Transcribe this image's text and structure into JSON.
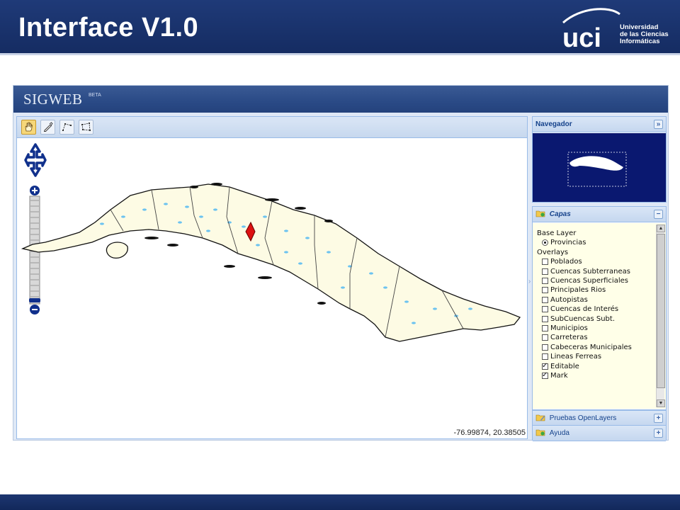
{
  "slide": {
    "title": "Interface V1.0",
    "logo": {
      "mark": "uci",
      "lines": [
        "Universidad",
        "de las Ciencias",
        "Informáticas"
      ]
    }
  },
  "app": {
    "brand": "SIGWEB",
    "brand_sup": "BETA"
  },
  "toolbar": {
    "tools": [
      {
        "name": "pan-hand-icon",
        "active": true
      },
      {
        "name": "draw-feature-icon",
        "active": false
      },
      {
        "name": "draw-line-icon",
        "active": false
      },
      {
        "name": "draw-polygon-icon",
        "active": false
      }
    ]
  },
  "map": {
    "coordinates": "-76.99874, 20.38505",
    "marker_color": "#dd1111",
    "land_color": "#fdfbe4",
    "water_color": "#6cc3f0"
  },
  "panels": {
    "navigator": {
      "title": "Navegador",
      "toggle": "»"
    },
    "layers": {
      "title": "Capas",
      "toggle": "−",
      "base_layer_label": "Base Layer",
      "base_layers": [
        {
          "label": "Provincias",
          "checked": true
        }
      ],
      "overlays_label": "Overlays",
      "overlays": [
        {
          "label": "Poblados",
          "checked": false
        },
        {
          "label": "Cuencas Subterraneas",
          "checked": false
        },
        {
          "label": "Cuencas Superficiales",
          "checked": false
        },
        {
          "label": "Principales Rios",
          "checked": false
        },
        {
          "label": "Autopistas",
          "checked": false
        },
        {
          "label": "Cuencas de Interés",
          "checked": false
        },
        {
          "label": "SubCuencas Subt.",
          "checked": false
        },
        {
          "label": "Municipios",
          "checked": false
        },
        {
          "label": "Carreteras",
          "checked": false
        },
        {
          "label": "Cabeceras Municipales",
          "checked": false
        },
        {
          "label": "Lineas Ferreas",
          "checked": false
        },
        {
          "label": "Editable",
          "checked": true
        },
        {
          "label": "Mark",
          "checked": true
        }
      ]
    },
    "openlayers": {
      "title": "Pruebas OpenLayers",
      "toggle": "+"
    },
    "help": {
      "title": "Ayuda",
      "toggle": "+"
    }
  },
  "colors": {
    "header_bg": "#1f3a78",
    "panel_header_text": "#15428b",
    "navigator_bg": "#0a1870"
  }
}
